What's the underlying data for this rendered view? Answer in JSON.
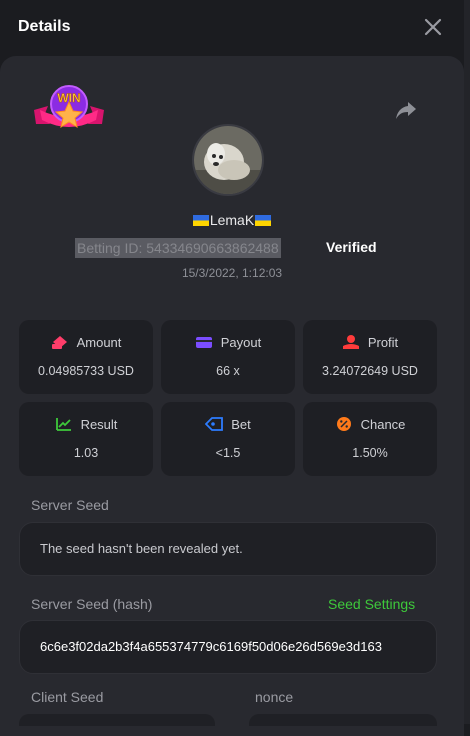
{
  "header": {
    "title": "Details",
    "close_icon": "close-icon"
  },
  "profile": {
    "badge_text": "WIN",
    "share_icon": "share-icon",
    "username": "LemaK",
    "betting_id": "Betting ID: 54334690663862488",
    "verified_label": "Verified",
    "datetime": "15/3/2022, 1:12:03"
  },
  "stats": [
    {
      "label": "Amount",
      "value": "0.04985733 USD",
      "icon": "amount-icon",
      "color": "#ff3d6a"
    },
    {
      "label": "Payout",
      "value": "66 x",
      "icon": "payout-icon",
      "color": "#7b4dff"
    },
    {
      "label": "Profit",
      "value": "3.24072649 USD",
      "icon": "profit-icon",
      "color": "#ff3b3b"
    },
    {
      "label": "Result",
      "value": "1.03",
      "icon": "result-icon",
      "color": "#3ec93b"
    },
    {
      "label": "Bet",
      "value": "<1.5",
      "icon": "bet-icon",
      "color": "#2d7cff"
    },
    {
      "label": "Chance",
      "value": "1.50%",
      "icon": "chance-icon",
      "color": "#ff7a1a"
    }
  ],
  "server_seed": {
    "label": "Server Seed",
    "value": "The seed hasn't been revealed yet."
  },
  "server_seed_hash": {
    "label": "Server Seed (hash)",
    "settings_link": "Seed Settings",
    "value": "6c6e3f02da2b3f4a655374779c6169f50d06e26d569e3d163"
  },
  "client_seed": {
    "label": "Client Seed"
  },
  "nonce": {
    "label": "nonce"
  }
}
